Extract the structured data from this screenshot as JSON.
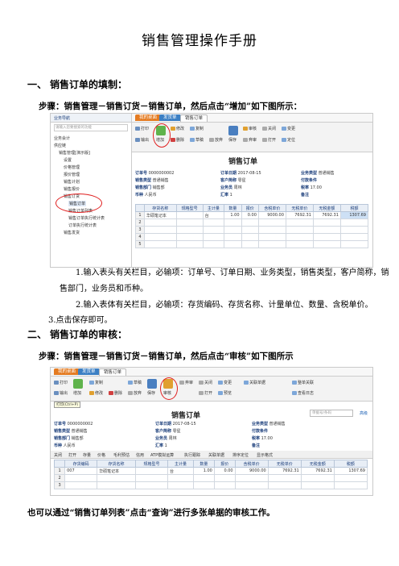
{
  "doc": {
    "title": "销售管理操作手册",
    "sec1_num": "一、",
    "sec1_title": "销售订单的填制：",
    "step1": "步骤：销售管理－销售订货－销售订单，然后点击“增加”如下图所示：",
    "item1a": "1.输入表头有关栏目，必输项：订单号、订单日期、业务类型，销售类型，客户简称，销",
    "item1b": "售部门，业务员和币种。",
    "item2": "2.输入表体有关栏目，必输项：存货编码、存货名称、计量单位、数量、含税单价。",
    "item3": "3.点击保存即可。",
    "sec2_num": "二、",
    "sec2_title": "销售订单的审核：",
    "step2": "步骤：销售管理－销售订货－销售订单，然后点击“审核”如下图所示",
    "footer": "也可以通过“销售订单列表”点击“查询”进行多张单据的审核工作。"
  },
  "shot1": {
    "nav_header": "业务导航",
    "search_ph": "请输入您要搜索的功能",
    "tree": [
      "业务会计",
      "供应链",
      "销售管理[演示版]",
      "设置",
      "价格管理",
      "报价管理",
      "销售计划",
      "销售报价",
      "销售订货",
      "销售订单",
      "销售订单列表",
      "销售订单执行统计表",
      "订单执行统计表",
      "销售发货"
    ],
    "tabs": [
      "我的桌面",
      "发货单",
      "销售订单"
    ],
    "ribbon": [
      "打印",
      "输出",
      "增加",
      "修改",
      "删除",
      "复制",
      "草稿",
      "放弃",
      "保存",
      "审核",
      "弃审",
      "关闭",
      "打开",
      "变更",
      "定位"
    ],
    "form_title": "销售订单",
    "fields": [
      [
        "订单号",
        "0000000002"
      ],
      [
        "订单日期",
        "2017-08-15"
      ],
      [
        "业务类型",
        "普通销售"
      ],
      [
        "销售类型",
        "普通销售"
      ],
      [
        "客户简称",
        "零星"
      ],
      [
        "付款条件",
        ""
      ],
      [
        "销售部门",
        "销售部"
      ],
      [
        "业务员",
        "周林"
      ],
      [
        "税率",
        "17.00"
      ],
      [
        "币种",
        "人民币"
      ],
      [
        "汇率",
        "1"
      ],
      [
        "备注",
        ""
      ]
    ],
    "cols": [
      "",
      "存货名称",
      "规格型号",
      "主计量",
      "数量",
      "报价",
      "含税单价",
      "无税单价",
      "无税金额",
      "税额"
    ],
    "rows": [
      [
        "1",
        "华硕笔记本",
        "",
        "台",
        "1.00",
        "0.00",
        "9000.00",
        "7692.31",
        "7692.31",
        "1307.69"
      ],
      [
        "2",
        "",
        "",
        "",
        "",
        "",
        "",
        "",
        "",
        ""
      ],
      [
        "3",
        "",
        "",
        "",
        "",
        "",
        "",
        "",
        "",
        ""
      ],
      [
        "4",
        "",
        "",
        "",
        "",
        "",
        "",
        "",
        "",
        ""
      ],
      [
        "5",
        "",
        "",
        "",
        "",
        "",
        "",
        "",
        "",
        ""
      ]
    ]
  },
  "shot2": {
    "tabs": [
      "我的桌面",
      "发货单",
      "销售订单"
    ],
    "ribbon": [
      "打印",
      "输出",
      "增加",
      "复制",
      "修改",
      "删除",
      "草稿",
      "放弃",
      "保存",
      "审核",
      "弃审",
      "关闭",
      "打开",
      "变更",
      "预览",
      "关联单据",
      "整单关联",
      "查看日志"
    ],
    "tooltip": "打印(Ctrl+P)",
    "search_ph": "单据号/条码",
    "advanced": "高级",
    "form_title": "销售订单",
    "fields": [
      [
        "订单号",
        "0000000002"
      ],
      [
        "订单日期",
        "2017-08-15"
      ],
      [
        "业务类型",
        "普通销售"
      ],
      [
        "销售类型",
        "普通销售"
      ],
      [
        "客户简称",
        "零星"
      ],
      [
        "付款条件",
        ""
      ],
      [
        "销售部门",
        "销售部"
      ],
      [
        "业务员",
        "周林"
      ],
      [
        "税率",
        "17.00"
      ],
      [
        "币种",
        "人民币"
      ],
      [
        "汇率",
        "1"
      ],
      [
        "备注",
        ""
      ]
    ],
    "subtool": [
      "关闭",
      "打开",
      "存量",
      "价格",
      "毛利预估",
      "信用",
      "ATP模拟运算",
      "执行跟踪",
      "关联单据",
      "排序定位",
      "显示格式"
    ],
    "cols": [
      "",
      "存货编码",
      "存货名称",
      "规格型号",
      "主计量",
      "数量",
      "报价",
      "含税单价",
      "无税单价",
      "无税金额",
      "税额"
    ],
    "rows": [
      [
        "1",
        "007",
        "华硕笔记本",
        "",
        "台",
        "1.00",
        "0.00",
        "9000.00",
        "7692.31",
        "7692.31",
        "1307.69"
      ],
      [
        "2",
        "",
        "",
        "",
        "",
        "",
        "",
        "",
        "",
        "",
        ""
      ],
      [
        "3",
        "",
        "",
        "",
        "",
        "",
        "",
        "",
        "",
        "",
        ""
      ]
    ]
  }
}
